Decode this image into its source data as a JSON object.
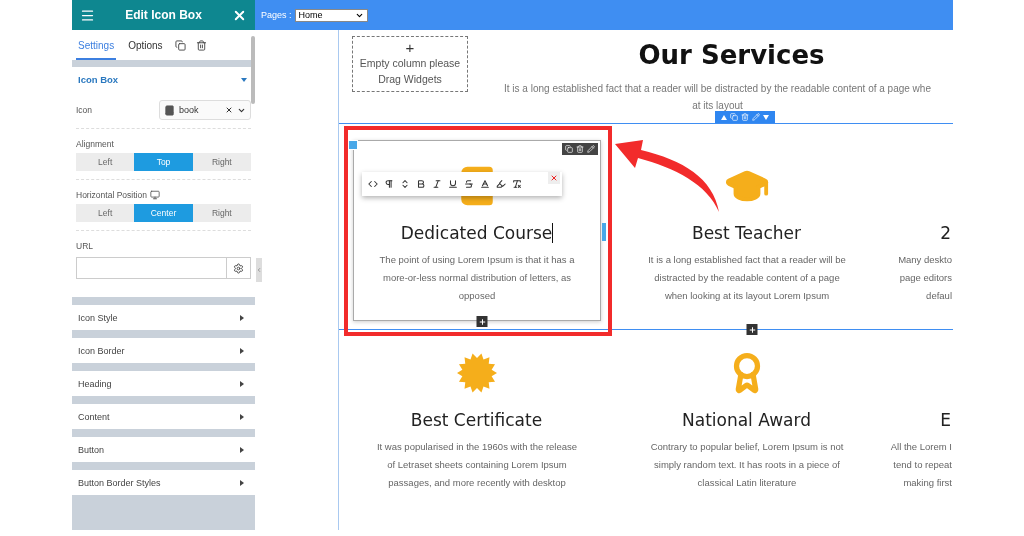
{
  "sidebar": {
    "title": "Edit Icon Box",
    "tabs": [
      {
        "label": "Settings",
        "selected": true
      },
      {
        "label": "Options",
        "selected": false
      }
    ],
    "panel": {
      "title": "Icon Box",
      "expanded": true,
      "icon_field": {
        "label": "Icon",
        "value": "book"
      },
      "alignment": {
        "label": "Alignment",
        "options": [
          {
            "label": "Left",
            "selected": false
          },
          {
            "label": "Top",
            "selected": true
          },
          {
            "label": "Right",
            "selected": false
          }
        ]
      },
      "horizontal_position": {
        "label": "Horizontal Position",
        "options": [
          {
            "label": "Left",
            "selected": false
          },
          {
            "label": "Center",
            "selected": true
          },
          {
            "label": "Right",
            "selected": false
          }
        ]
      },
      "url": {
        "label": "URL"
      }
    },
    "sections": [
      {
        "title": "Icon Style",
        "expanded": false
      },
      {
        "title": "Icon Border",
        "expanded": false
      },
      {
        "title": "Heading",
        "expanded": false
      },
      {
        "title": "Content",
        "expanded": false
      },
      {
        "title": "Button",
        "expanded": false
      },
      {
        "title": "Button Border Styles",
        "expanded": false
      }
    ]
  },
  "topbar": {
    "label": "Pages :",
    "page": "Home"
  },
  "canvas": {
    "empty_column": {
      "symbol": "+",
      "lines": [
        "Empty column please",
        "Drag Widgets"
      ]
    },
    "heading": "Our Services",
    "subtitle": [
      "It is a long established fact that a reader will be distracted by the readable content of a page whe",
      "at its layout"
    ],
    "rows": [
      {
        "selected": true,
        "cards": [
          {
            "kind": "book",
            "heading": "Dedicated Course",
            "lines": [
              "The point of using Lorem Ipsum is that it has a",
              "more-or-less normal distribution of letters, as",
              "opposed"
            ],
            "selected": true,
            "add_button": true
          },
          {
            "kind": "cap",
            "heading": "Best Teacher",
            "lines": [
              "It is a long established fact that a reader will be",
              "distracted by the readable content of a page",
              "when looking at its layout Lorem Ipsum"
            ],
            "selected": false,
            "add_button": true
          },
          {
            "kind": "cut",
            "heading": "2",
            "lines": [
              "Many deskto",
              "page editors",
              "defaul"
            ],
            "selected": false
          }
        ]
      },
      {
        "selected": false,
        "cards": [
          {
            "kind": "certificate",
            "heading": "Best Certificate",
            "lines": [
              "It was popularised in the 1960s with the release",
              "of Letraset sheets containing Lorem Ipsum",
              "passages, and more recently with desktop"
            ],
            "selected": false
          },
          {
            "kind": "award",
            "heading": "National Award",
            "lines": [
              "Contrary to popular belief, Lorem Ipsum is not",
              "simply random text. It has roots in a piece of",
              "classical Latin literature"
            ],
            "selected": false
          },
          {
            "kind": "cut",
            "heading": "E",
            "lines": [
              "All the Lorem I",
              "tend to repeat",
              "making first"
            ],
            "selected": false
          }
        ]
      }
    ]
  }
}
